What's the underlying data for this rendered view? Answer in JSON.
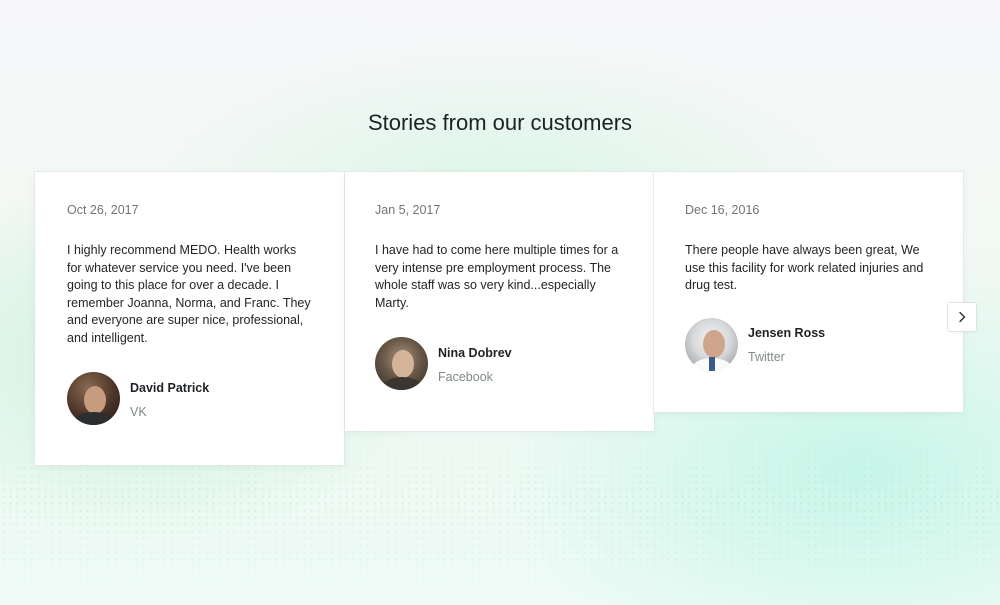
{
  "section": {
    "title": "Stories from our customers"
  },
  "testimonials": [
    {
      "date": "Oct 26, 2017",
      "quote": "I highly recommend MEDO. Health works for whatever service you need. I've been going to this place for over a decade. I remember Joanna, Norma, and Franc. They and everyone are super nice, professional, and intelligent.",
      "name": "David Patrick",
      "source": "VK"
    },
    {
      "date": "Jan 5, 2017",
      "quote": "I have had to come here multiple times for a very intense pre employment process. The whole staff was so very kind...especially Marty.",
      "name": "Nina Dobrev",
      "source": "Facebook"
    },
    {
      "date": "Dec 16, 2016",
      "quote": "There people have always been great, We use this facility for work related injuries and drug test.",
      "name": "Jensen Ross",
      "source": "Twitter"
    }
  ],
  "carousel": {
    "next_icon": "chevron-right-icon"
  }
}
